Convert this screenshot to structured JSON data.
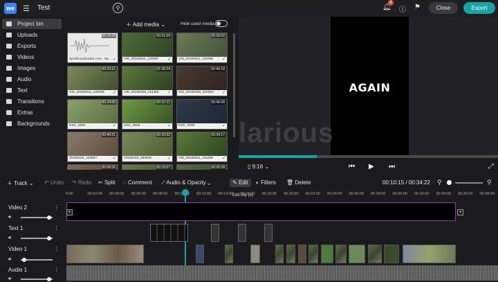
{
  "header": {
    "logo": "we",
    "project_title": "Test",
    "notification_count": "4",
    "close_label": "Close",
    "export_label": "Export"
  },
  "sidebar": {
    "items": [
      {
        "label": "Project bin",
        "icon": "folder-icon"
      },
      {
        "label": "Uploads",
        "icon": "upload-icon"
      },
      {
        "label": "Exports",
        "icon": "export-icon"
      },
      {
        "label": "Videos",
        "icon": "video-icon"
      },
      {
        "label": "Images",
        "icon": "image-icon"
      },
      {
        "label": "Audio",
        "icon": "audio-icon"
      },
      {
        "label": "Text",
        "icon": "text-icon"
      },
      {
        "label": "Transitions",
        "icon": "transitions-icon"
      },
      {
        "label": "Extras",
        "icon": "extras-icon"
      },
      {
        "label": "Backgrounds",
        "icon": "backgrounds-icon"
      }
    ]
  },
  "media": {
    "add_label": "Add media",
    "hide_used_label": "Hide used media",
    "tiles": [
      {
        "name": "SpotiDownloader.com - My ...",
        "duration": "05:19:00"
      },
      {
        "name": "VID_20220511_120307",
        "duration": "00:31:09"
      },
      {
        "name": "VID_20220511_115258",
        "duration": "00:20:02"
      },
      {
        "name": "VID_20220512_105338",
        "duration": "00:10:21"
      },
      {
        "name": "VID_20230409_114455",
        "duration": "01:06:24"
      },
      {
        "name": "VID_20230408_202303",
        "duration": "00:46:18"
      },
      {
        "name": "DSC_0600",
        "duration": "00:24:00"
      },
      {
        "name": "DSC_0656",
        "duration": "00:22:21"
      },
      {
        "name": "DSC_0096",
        "duration": "00:45:08"
      },
      {
        "name": "20230410_123927",
        "duration": "00:40:21"
      },
      {
        "name": "20230410_093640",
        "duration": "00:10:02"
      },
      {
        "name": "VID_20220511_115405",
        "duration": "00:34:17"
      },
      {
        "name": "",
        "duration": "00:06:06"
      },
      {
        "name": "",
        "duration": "00:15:07"
      },
      {
        "name": "",
        "duration": "00:05:08"
      }
    ]
  },
  "preview": {
    "overlay_text": "AGAIN",
    "watermark": "larious",
    "aspect_ratio": "9:16",
    "progress_fraction": 0.3
  },
  "toolbar": {
    "track": "Track",
    "undo": "Undo",
    "redo": "Redo",
    "split": "Split",
    "comment": "Comment",
    "audio_opacity": "Audio & Opacity",
    "edit": "Edit",
    "filters": "Filters",
    "delete": "Delete",
    "tooltip": "Edit clip (e)",
    "timecode": "00:10:15 / 00:34:22"
  },
  "ruler": {
    "ticks": [
      "0:00",
      "00:02:00",
      "00:04:00",
      "00:06:00",
      "00:08:00",
      "00:10:00",
      "00:12:00",
      "00:14:00",
      "00:16:00",
      "00:18:00",
      "00:20:00",
      "00:22:00",
      "00:24:00",
      "00:26:00",
      "00:28:00",
      "00:30:00",
      "00:32:00",
      "00:34:00",
      "00:36:00",
      "00:38:00"
    ]
  },
  "tracks": {
    "video2": "Video 2",
    "text1": "Text 1",
    "video1": "Video 1",
    "audio1": "Audio 1"
  },
  "colors": {
    "accent": "#1aa3a3",
    "selected_clip_border": "#8d3bb8",
    "badge": "#e5532d"
  }
}
